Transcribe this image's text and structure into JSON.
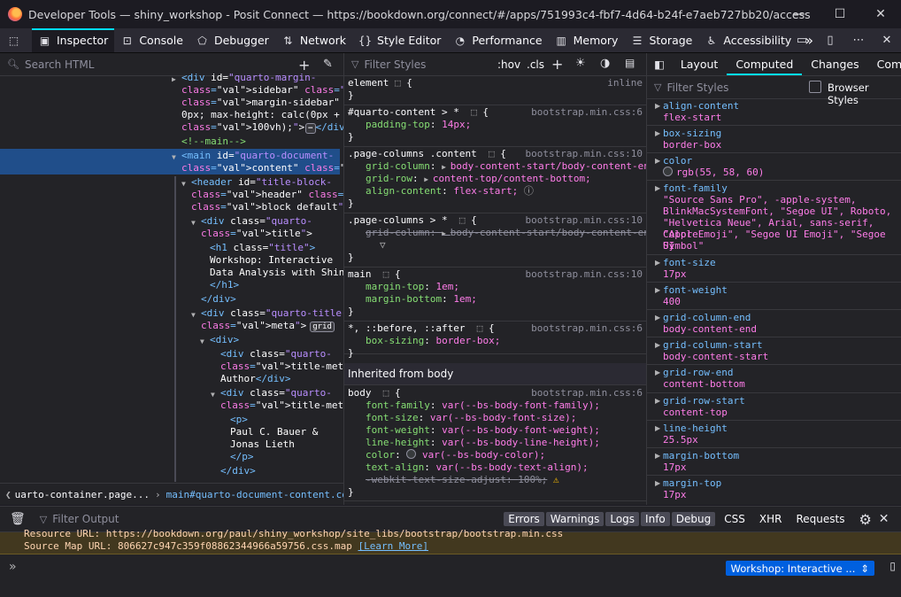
{
  "window": {
    "title": "Developer Tools — shiny_workshop - Posit Connect — https://bookdown.org/connect/#/apps/751993c4-fbf7-4d64-b24f-e7aeb727bb20/access",
    "minimize": "—",
    "maximize": "☐",
    "close": "✕"
  },
  "toolbar": {
    "tools": [
      {
        "label": "Inspector",
        "icon": "inspector-icon"
      },
      {
        "label": "Console",
        "icon": "console-icon"
      },
      {
        "label": "Debugger",
        "icon": "debugger-icon"
      },
      {
        "label": "Network",
        "icon": "network-icon"
      },
      {
        "label": "Style Editor",
        "icon": "style-editor-icon"
      },
      {
        "label": "Performance",
        "icon": "performance-icon"
      },
      {
        "label": "Memory",
        "icon": "memory-icon"
      },
      {
        "label": "Storage",
        "icon": "storage-icon"
      },
      {
        "label": "Accessibility",
        "icon": "accessibility-icon"
      }
    ],
    "overflow": "»"
  },
  "markup": {
    "search_placeholder": "Search HTML",
    "lines": [
      {
        "t": "<div id=\"quarto-margin-"
      },
      {
        "t": "sidebar\" class=\"sidebar"
      },
      {
        "t": "margin-sidebar\" style=\"top:"
      },
      {
        "t": "0px; max-height: calc(0px +"
      },
      {
        "t": "100vh);\">"
      },
      {
        "t": "<!--main-->"
      },
      {
        "t": "<main id=\"quarto-document-"
      },
      {
        "t": "content\" class=\"content\">"
      },
      {
        "t": "<header id=\"title-block-"
      },
      {
        "t": "header\" class=\"quarto-title-"
      },
      {
        "t": "block default\">"
      },
      {
        "t": "<div class=\"quarto-"
      },
      {
        "t": "title\">"
      },
      {
        "t": "<h1 class=\"title\">"
      },
      {
        "t": "Workshop: Interactive"
      },
      {
        "t": "Data Analysis with Shiny"
      },
      {
        "t": "</h1>"
      },
      {
        "t": "</div>"
      },
      {
        "t": "<div class=\"quarto-title-"
      },
      {
        "t": "meta\">"
      },
      {
        "t": "<div>"
      },
      {
        "t": "<div class=\"quarto-"
      },
      {
        "t": "title-meta-heading\">"
      },
      {
        "t": "Author</div>"
      },
      {
        "t": "<div class=\"quarto-"
      },
      {
        "t": "title-meta-contents\">"
      },
      {
        "t": "<p>"
      },
      {
        "t": "Paul C. Bauer &"
      },
      {
        "t": "Jonas Lieth"
      },
      {
        "t": "</p>"
      },
      {
        "t": "</div>"
      }
    ],
    "tail_close": "</div>",
    "grid_badge": "grid",
    "ellipsis_badge": "⋯",
    "breadcrumb": [
      "uarto-container.page...",
      "main#quarto-document-content.content"
    ]
  },
  "rules": {
    "filter_placeholder": "Filter Styles",
    "hov": ":hov",
    "cls": ".cls",
    "blocks": [
      {
        "selector": "element",
        "source": "inline",
        "props": []
      },
      {
        "selector": "#quarto-content > * ",
        "source": "bootstrap.min.css:6",
        "props": [
          {
            "n": "padding-top",
            "v": "14px;"
          }
        ]
      },
      {
        "selector": ".page-columns .content ",
        "source": "bootstrap.min.css:10",
        "props": [
          {
            "n": "grid-column",
            "v": "body-content-start/body-content-end;"
          },
          {
            "n": "grid-row",
            "v": "content-top/content-bottom;"
          },
          {
            "n": "align-content",
            "v": "flex-start;"
          }
        ]
      },
      {
        "selector": ".page-columns > * ",
        "source": "bootstrap.min.css:10",
        "props": [
          {
            "n": "grid-column",
            "v": "body-content-start/body-content-end;",
            "struck": true
          }
        ]
      },
      {
        "selector": "main ",
        "source": "bootstrap.min.css:10",
        "props": [
          {
            "n": "margin-top",
            "v": "1em;"
          },
          {
            "n": "margin-bottom",
            "v": "1em;"
          }
        ]
      },
      {
        "selector": "*, ::before, ::after ",
        "source": "bootstrap.min.css:6",
        "props": [
          {
            "n": "box-sizing",
            "v": "border-box;"
          }
        ]
      }
    ],
    "inherited_heading": "Inherited from body",
    "body": {
      "selector": "body ",
      "source": "bootstrap.min.css:6",
      "props": [
        {
          "n": "font-family",
          "v": "var(--bs-body-font-family);"
        },
        {
          "n": "font-size",
          "v": "var(--bs-body-font-size);"
        },
        {
          "n": "font-weight",
          "v": "var(--bs-body-font-weight);"
        },
        {
          "n": "line-height",
          "v": "var(--bs-body-line-height);"
        },
        {
          "n": "color",
          "v": "var(--bs-body-color);"
        },
        {
          "n": "text-align",
          "v": "var(--bs-body-text-align);"
        },
        {
          "n": "-webkit-text-size-adjust",
          "v": "100%;",
          "struck": true
        }
      ]
    },
    "open_brace": "{",
    "close_brace": "}"
  },
  "computed": {
    "tabs": [
      "Layout",
      "Computed",
      "Changes",
      "Com"
    ],
    "active_tab": "Computed",
    "filter_placeholder": "Filter Styles",
    "browser_styles_label": "Browser Styles",
    "properties": [
      {
        "name": "align-content",
        "value": [
          "flex-start"
        ]
      },
      {
        "name": "box-sizing",
        "value": [
          "border-box"
        ]
      },
      {
        "name": "color",
        "value": [
          "rgb(55, 58, 60)"
        ],
        "swatch": "#373a3c"
      },
      {
        "name": "font-family",
        "value": [
          "\"Source Sans Pro\", -apple-system,",
          "BlinkMacSystemFont, \"Segoe UI\", Roboto,",
          "\"Helvetica Neue\", Arial, sans-serif, \"Apple",
          "Color Emoji\", \"Segoe UI Emoji\", \"Segoe UI",
          "Symbol\""
        ]
      },
      {
        "name": "font-size",
        "value": [
          "17px"
        ]
      },
      {
        "name": "font-weight",
        "value": [
          "400"
        ]
      },
      {
        "name": "grid-column-end",
        "value": [
          "body-content-end"
        ]
      },
      {
        "name": "grid-column-start",
        "value": [
          "body-content-start"
        ]
      },
      {
        "name": "grid-row-end",
        "value": [
          "content-bottom"
        ]
      },
      {
        "name": "grid-row-start",
        "value": [
          "content-top"
        ]
      },
      {
        "name": "line-height",
        "value": [
          "25.5px"
        ]
      },
      {
        "name": "margin-bottom",
        "value": [
          "17px"
        ]
      },
      {
        "name": "margin-top",
        "value": [
          "17px"
        ]
      }
    ]
  },
  "console": {
    "filter_placeholder": "Filter Output",
    "filters": [
      "Errors",
      "Warnings",
      "Logs",
      "Info",
      "Debug"
    ],
    "extra_filters": [
      "CSS",
      "XHR",
      "Requests"
    ],
    "messages": [
      {
        "text": "Resource URL: https://bookdown.org/paul/shiny_workshop/site_libs/bootstrap/bootstrap.min.css"
      },
      {
        "text": "Source Map URL: 806627c947c359f08862344966a59756.css.map ",
        "link": "[Learn More]"
      }
    ],
    "prompt": "»",
    "context": "Workshop: Interactive ..."
  },
  "colors": {
    "accent": "#00ddff",
    "selection": "#204e8a",
    "panel": "#232327"
  }
}
